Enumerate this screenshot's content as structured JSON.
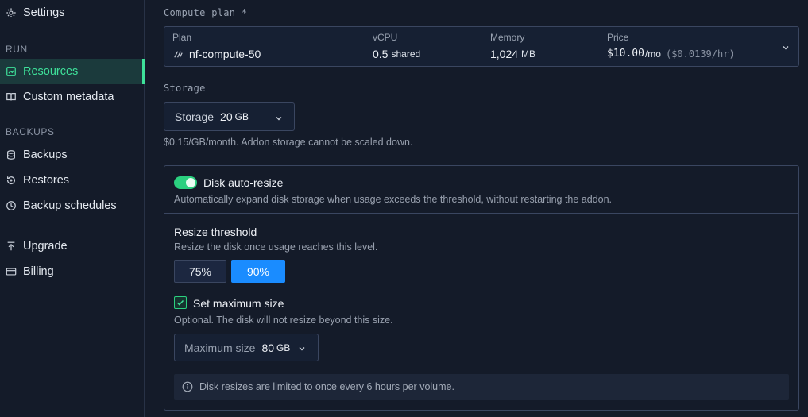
{
  "sidebar": {
    "settings_label": "Settings",
    "run_section": "RUN",
    "run_items": [
      {
        "label": "Resources",
        "icon": "resources-icon",
        "active": true
      },
      {
        "label": "Custom metadata",
        "icon": "book-icon",
        "active": false
      }
    ],
    "backups_section": "BACKUPS",
    "backup_items": [
      {
        "label": "Backups",
        "icon": "database-icon"
      },
      {
        "label": "Restores",
        "icon": "restore-icon"
      },
      {
        "label": "Backup schedules",
        "icon": "clock-icon"
      }
    ],
    "other_items": [
      {
        "label": "Upgrade",
        "icon": "upgrade-icon"
      },
      {
        "label": "Billing",
        "icon": "credit-card-icon"
      }
    ]
  },
  "compute": {
    "label": "Compute plan *",
    "plan_header": "Plan",
    "plan_value": "nf-compute-50",
    "vcpu_header": "vCPU",
    "vcpu_value": "0.5",
    "vcpu_unit": "shared",
    "memory_header": "Memory",
    "memory_value": "1,024",
    "memory_unit": "MB",
    "price_header": "Price",
    "price_value": "$10.00",
    "price_unit": "/mo",
    "price_hourly": "($0.0139/hr)"
  },
  "storage": {
    "label": "Storage",
    "select_label": "Storage",
    "select_value": "20",
    "select_unit": "GB",
    "hint": "$0.15/GB/month. Addon storage cannot be scaled down."
  },
  "autoresize": {
    "title": "Disk auto-resize",
    "enabled": true,
    "description": "Automatically expand disk storage when usage exceeds the threshold, without restarting the addon.",
    "threshold_title": "Resize threshold",
    "threshold_desc": "Resize the disk once usage reaches this level.",
    "options": [
      "75%",
      "90%"
    ],
    "selected": "90%",
    "max_checkbox_label": "Set maximum size",
    "max_checked": true,
    "max_desc": "Optional. The disk will not resize beyond this size.",
    "max_select_label": "Maximum size",
    "max_select_value": "80",
    "max_select_unit": "GB",
    "info": "Disk resizes are limited to once every 6 hours per volume."
  },
  "colors": {
    "accent_green": "#3ee19a",
    "accent_blue": "#1a8cff",
    "background": "#141b29"
  }
}
